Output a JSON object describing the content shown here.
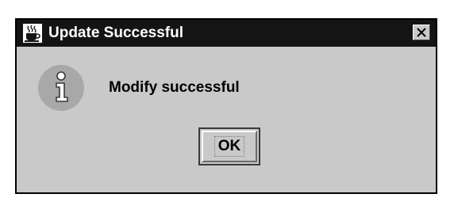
{
  "dialog": {
    "title": "Update Successful",
    "message": "Modify successful",
    "ok_label": "OK",
    "title_icon": "java-coffee-cup-icon",
    "message_icon": "information-icon",
    "close_icon": "close-icon"
  },
  "colors": {
    "titlebar": "#141414",
    "title_text": "#ffffff",
    "body": "#c9c9c9",
    "info_circle": "#a8a8a8"
  }
}
